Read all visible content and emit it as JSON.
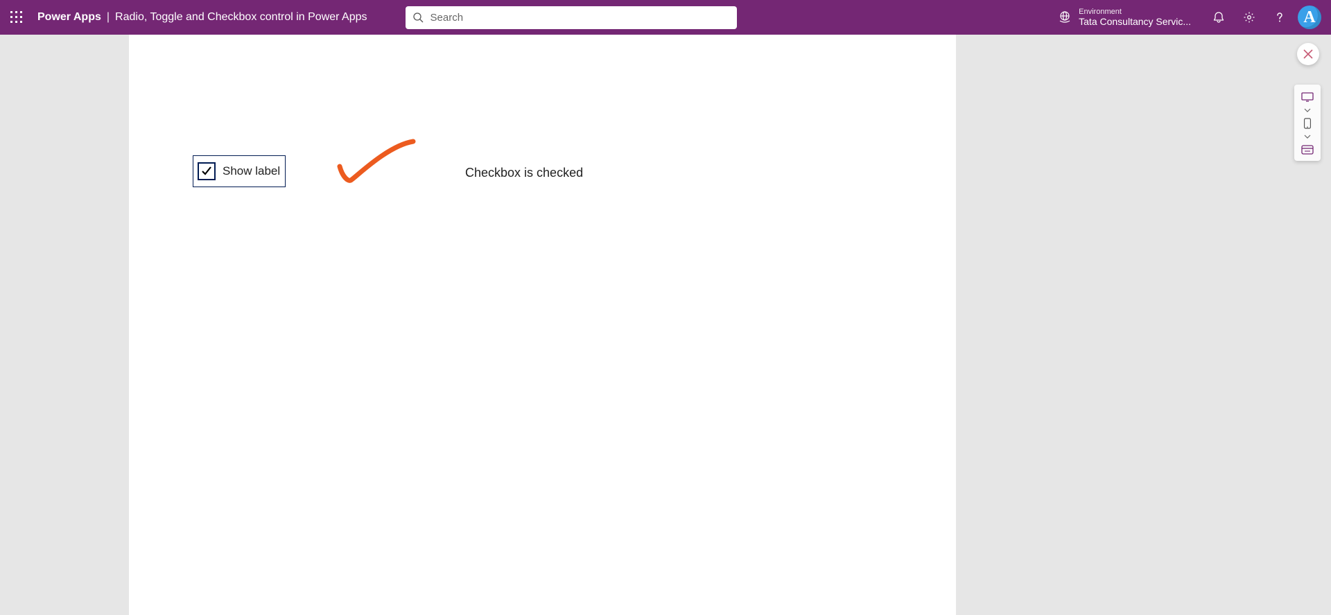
{
  "header": {
    "product": "Power Apps",
    "separator": "|",
    "app_name": "Radio, Toggle and Checkbox control in Power Apps",
    "search_placeholder": "Search",
    "environment_label": "Environment",
    "environment_name": "Tata Consultancy Servic...",
    "avatar_initial": "A"
  },
  "canvas": {
    "checkbox_label": "Show label",
    "checkbox_checked": true,
    "status_text": "Checkbox is checked"
  },
  "colors": {
    "brand": "#742774",
    "control_border": "#001b52",
    "annotation": "#ec5b1f",
    "close_x": "#c65a74"
  }
}
